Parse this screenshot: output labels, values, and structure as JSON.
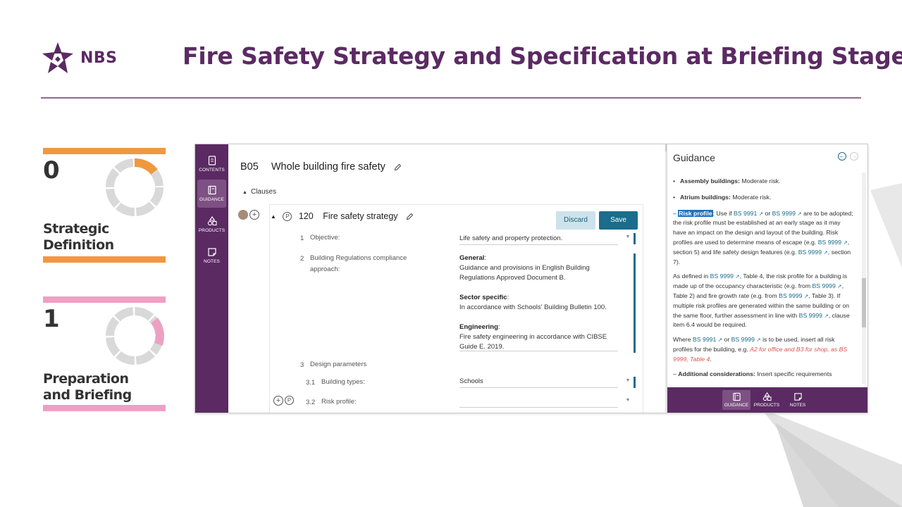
{
  "brand": {
    "name": "NBS",
    "color": "#5b2a63"
  },
  "slide_title": "Fire Safety Strategy and Specification at Briefing Stage",
  "stages": [
    {
      "number": "0",
      "name_line1": "Strategic",
      "name_line2": "Definition",
      "color": "#f0983e",
      "progress": 0.125
    },
    {
      "number": "1",
      "name_line1": "Preparation",
      "name_line2": "and Briefing",
      "color": "#eea0c3",
      "progress": 0.125
    }
  ],
  "rail": {
    "items": [
      {
        "label": "CONTENTS",
        "icon": "document-icon"
      },
      {
        "label": "GUIDANCE",
        "icon": "book-icon",
        "active": true
      },
      {
        "label": "PRODUCTS",
        "icon": "shapes-icon"
      },
      {
        "label": "NOTES",
        "icon": "note-icon"
      }
    ]
  },
  "document": {
    "code": "B05",
    "title": "Whole building fire safety",
    "clauses_toggle": "Clauses"
  },
  "clause": {
    "number": "120",
    "title": "Fire safety strategy",
    "discard_label": "Discard",
    "save_label": "Save",
    "rows": [
      {
        "num": "1",
        "label": "Objective:",
        "value": "Life safety and property protection."
      },
      {
        "num": "2",
        "label_line1": "Building Regulations compliance",
        "label_line2": "approach:",
        "general_heading": "General",
        "general_text1": "Guidance and provisions in English Building",
        "general_text2": "Regulations Approved Document B.",
        "sector_heading": "Sector specific",
        "sector_text": "In accordance with Schools' Building Bulletin 100.",
        "eng_heading": "Engineering",
        "eng_text1": "Fire safety engineering in accordance with CIBSE",
        "eng_text2": "Guide E. 2019."
      },
      {
        "num": "3",
        "label": "Design parameters"
      },
      {
        "num": "3.1",
        "label": "Building types:",
        "value": "Schools"
      },
      {
        "num": "3.2",
        "label": "Risk profile:",
        "value": ""
      }
    ]
  },
  "guidance": {
    "title": "Guidance",
    "bullet1_bold": "Assembly buildings:",
    "bullet1_text": " Moderate risk.",
    "bullet2_bold": "Atrium buildings:",
    "bullet2_text": " Moderate risk.",
    "risk_heading": "Risk profile",
    "risk_text_a": ": Use if ",
    "bs9991": "BS 9991",
    "or": " or ",
    "bs9999": "BS 9999",
    "risk_text_b": " are to be adopted; the risk profile must be established at an early stage as it may have an impact on the design and layout of the building. Risk profiles are used to determine means of escape (e.g. ",
    "risk_text_c": ", section 5) and life safety design features (e.g. ",
    "risk_text_d": ", section 7).",
    "p2_a": "As defined in ",
    "p2_b": ", Table 4, the risk profile for a building is made up of the occupancy characteristic (e.g. from ",
    "p2_c": ", Table 2) and fire growth rate (e.g. from ",
    "p2_d": ", Table 3). If multiple risk profiles are generated within the same building or on the same floor, further assessment in line with ",
    "p2_e": ", clause item 6.4 would be required.",
    "p3_a": "Where ",
    "p3_b": " is to be used, insert all risk profiles for the building, e.g. ",
    "p3_example": "A2 for office and B3 for shop, as BS 9999, Table 4",
    "p3_end": ".",
    "additional_bold": "Additional considerations:",
    "additional_text": " Insert specific requirements",
    "footer_items": [
      {
        "label": "GUIDANCE",
        "icon": "book-icon",
        "active": true
      },
      {
        "label": "PRODUCTS",
        "icon": "shapes-icon"
      },
      {
        "label": "NOTES",
        "icon": "note-icon"
      }
    ]
  }
}
